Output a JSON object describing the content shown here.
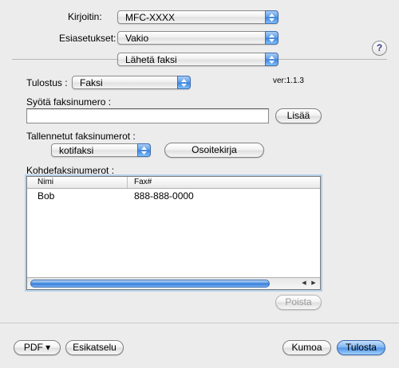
{
  "printer": {
    "label": "Kirjoitin:",
    "value": "MFC-XXXX"
  },
  "presets": {
    "label": "Esiasetukset:",
    "value": "Vakio"
  },
  "panel": {
    "value": "Lähetä faksi"
  },
  "version": "ver:1.1.3",
  "output": {
    "label": "Tulostus :",
    "value": "Faksi"
  },
  "fax_input": {
    "label": "Syötä faksinumero :",
    "value": "",
    "add_button": "Lisää"
  },
  "stored": {
    "label": "Tallennetut faksinumerot :",
    "value": "kotifaksi",
    "address_book_button": "Osoitekirja"
  },
  "destinations": {
    "label": "Kohdefaksinumerot :",
    "columns": [
      "Nimi",
      "Fax#"
    ],
    "rows": [
      {
        "name": "Bob",
        "fax": "888-888-0000"
      }
    ],
    "scroll_left": "◀",
    "scroll_right": "▶",
    "remove_button": "Poista"
  },
  "footer": {
    "pdf_button": "PDF ▾",
    "preview_button": "Esikatselu",
    "cancel_button": "Kumoa",
    "print_button": "Tulosta"
  },
  "help": "?"
}
